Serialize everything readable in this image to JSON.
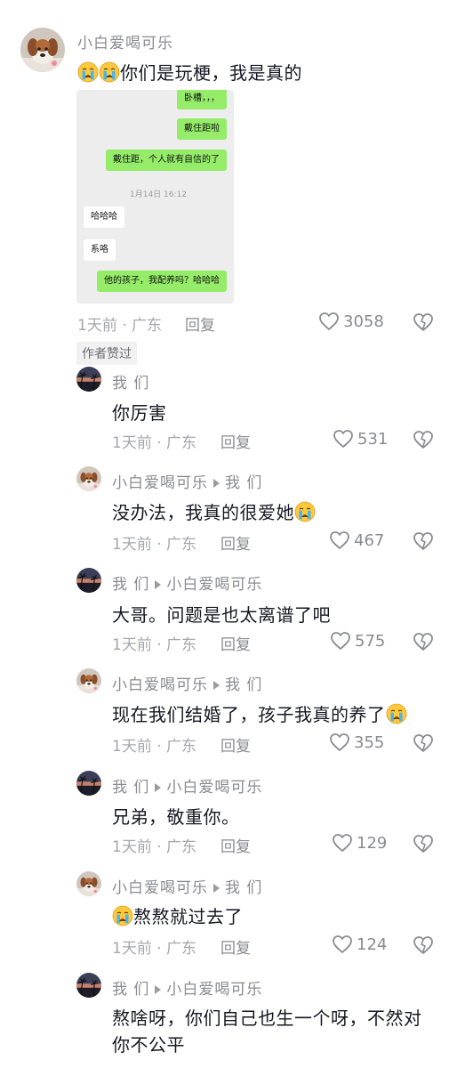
{
  "main_comment": {
    "author": "小白爱喝可乐",
    "text": "你们是玩梗，我是真的",
    "time": "1天前",
    "location": "广东",
    "reply_label": "回复",
    "likes": "3058",
    "badge": "作者赞过"
  },
  "chat_image": {
    "messages": [
      {
        "side": "right",
        "text": "卧槽，，，"
      },
      {
        "side": "right",
        "text": "戴住距啦"
      },
      {
        "side": "right",
        "text": "戴住距，个人就有自信的了"
      },
      {
        "side": "left",
        "text": "哈哈哈"
      },
      {
        "side": "left",
        "text": "系咯"
      },
      {
        "side": "right",
        "text": "他的孩子，我配养吗？哈哈哈"
      }
    ],
    "timestamp": "1月14日 16:12"
  },
  "replies": [
    {
      "from": "我 们",
      "to": "",
      "text": "你厉害",
      "time": "1天前",
      "location": "广东",
      "reply_label": "回复",
      "likes": "531"
    },
    {
      "from": "小白爱喝可乐",
      "to": "我 们",
      "text": "没办法，我真的很爱她",
      "time": "1天前",
      "location": "广东",
      "reply_label": "回复",
      "likes": "467"
    },
    {
      "from": "我 们",
      "to": "小白爱喝可乐",
      "text": "大哥。问题是也太离谱了吧",
      "time": "1天前",
      "location": "广东",
      "reply_label": "回复",
      "likes": "575"
    },
    {
      "from": "小白爱喝可乐",
      "to": "我 们",
      "text": "现在我们结婚了，孩子我真的养了",
      "time": "1天前",
      "location": "广东",
      "reply_label": "回复",
      "likes": "355"
    },
    {
      "from": "我 们",
      "to": "小白爱喝可乐",
      "text": "兄弟，敬重你。",
      "time": "1天前",
      "location": "广东",
      "reply_label": "回复",
      "likes": "129"
    },
    {
      "from": "小白爱喝可乐",
      "to": "我 们",
      "text": "熬熬就过去了",
      "time": "1天前",
      "location": "广东",
      "reply_label": "回复",
      "likes": "124"
    },
    {
      "from": "我 们",
      "to": "小白爱喝可乐",
      "text_line1": "熬啥呀，你们自己也生一个呀，不然对",
      "text_line2": "你不公平"
    }
  ]
}
